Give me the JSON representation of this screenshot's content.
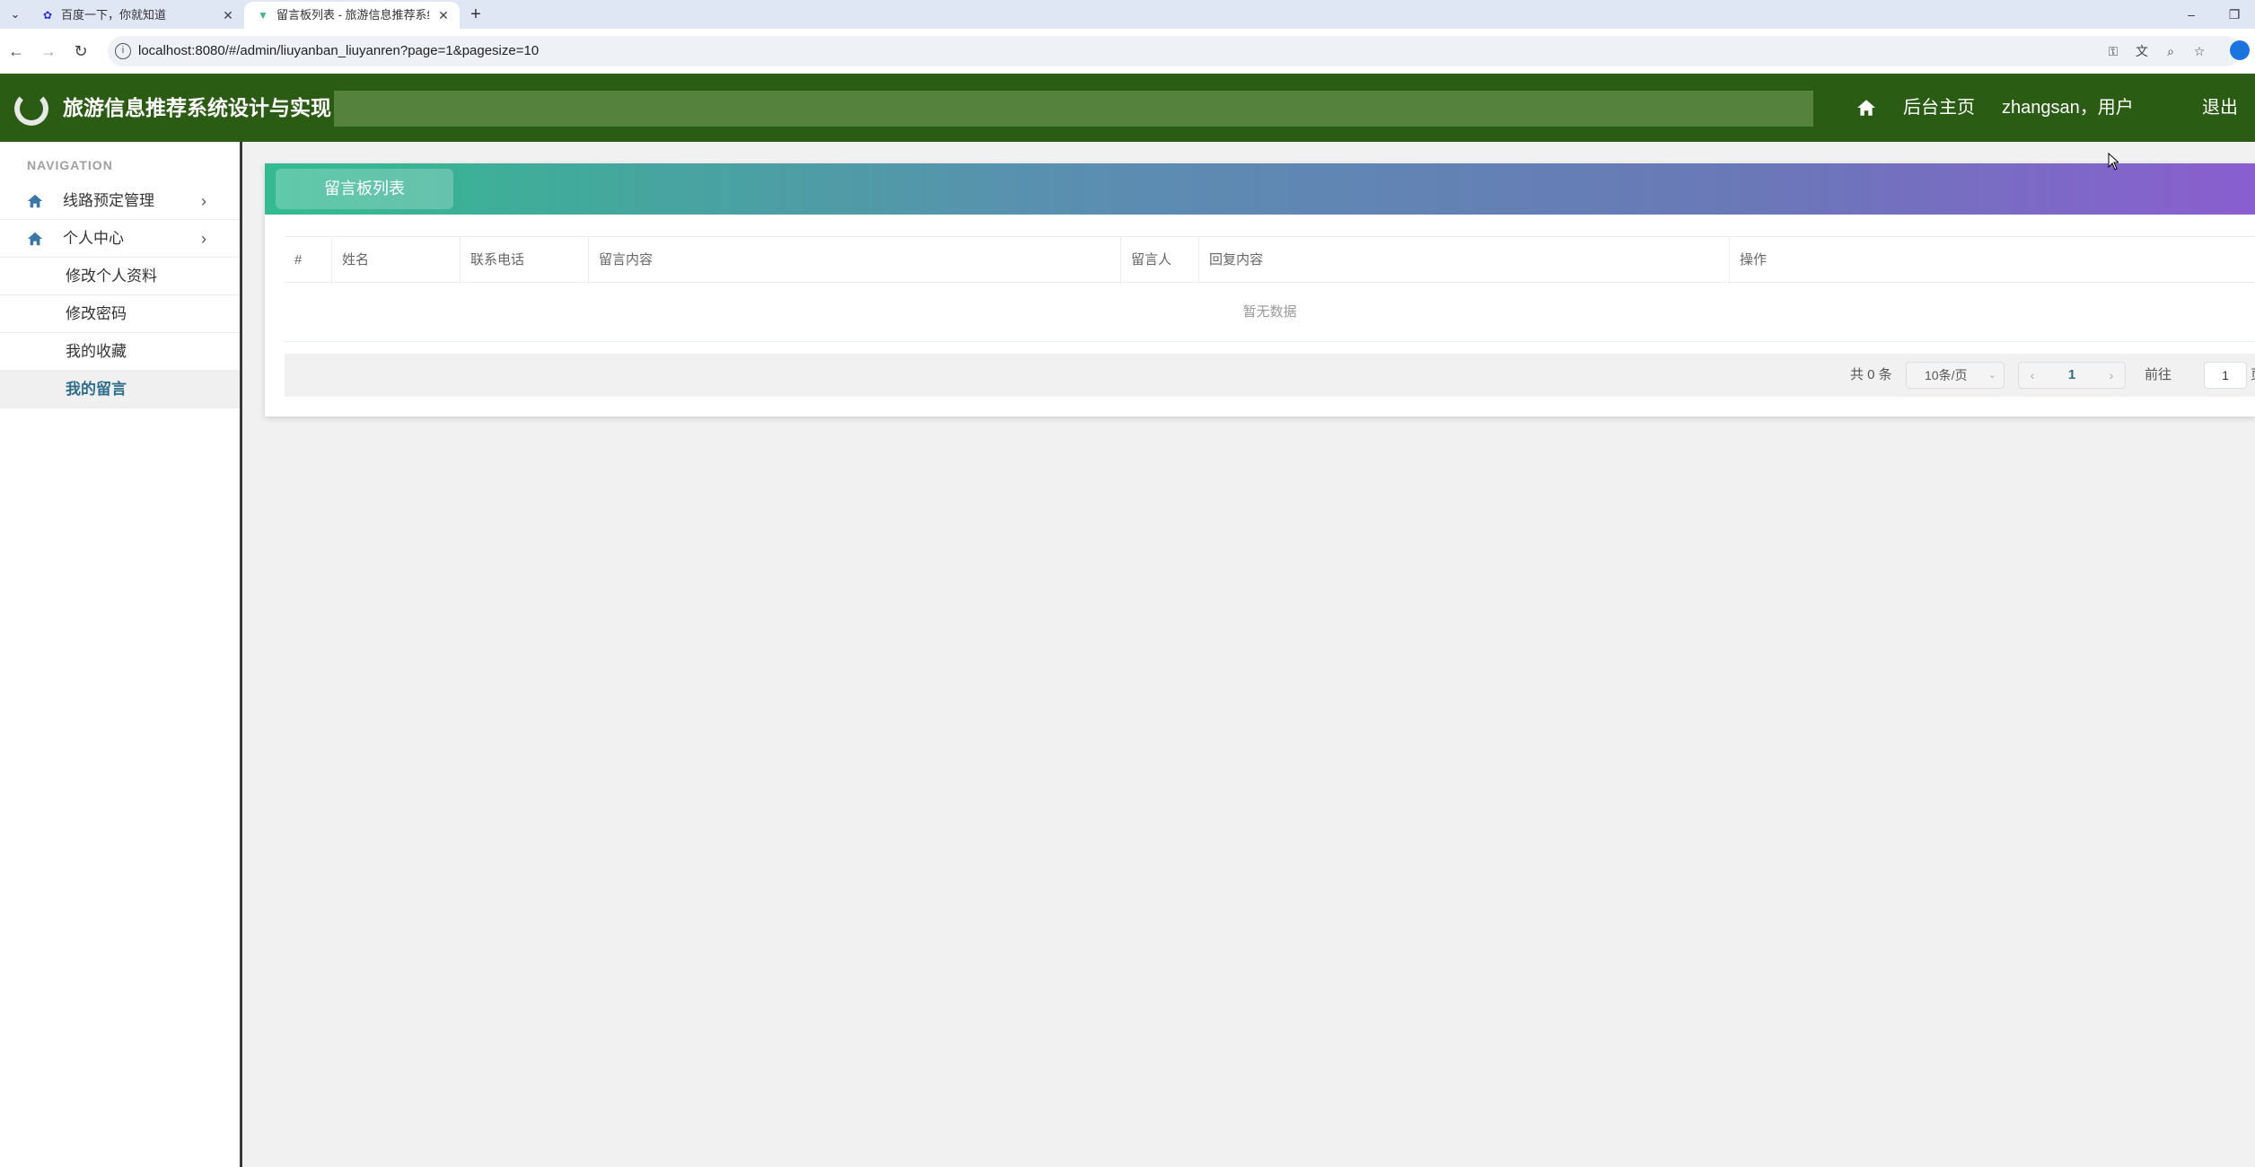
{
  "browser": {
    "tabs": [
      {
        "title": "百度一下，你就知道",
        "active": false
      },
      {
        "title": "留言板列表 - 旅游信息推荐系统",
        "active": true
      }
    ],
    "url": "localhost:8080/#/admin/liuyanban_liuyanren?page=1&pagesize=10",
    "profile_initial": "👤"
  },
  "header": {
    "title": "旅游信息推荐系统设计与实现",
    "home_link": "后台主页",
    "user": "zhangsan，用户",
    "logout": "退出",
    "colors": {
      "bar": "#2a5c13",
      "strip": "#55823c"
    }
  },
  "sidebar": {
    "heading": "NAVIGATION",
    "menus": [
      {
        "label": "线路预定管理",
        "icon": "home-icon"
      },
      {
        "label": "个人中心",
        "icon": "home-icon"
      }
    ],
    "sub_items": [
      "修改个人资料",
      "修改密码",
      "我的收藏",
      "我的留言"
    ],
    "active_sub": "我的留言"
  },
  "main": {
    "card_title": "留言板列表",
    "columns": [
      "#",
      "姓名",
      "联系电话",
      "留言内容",
      "留言人",
      "回复内容",
      "操作"
    ],
    "empty_text": "暂无数据",
    "pagination": {
      "total": "共 0 条",
      "page_size": "10条/页",
      "current": "1",
      "goto_label": "前往",
      "goto_value": "1",
      "page_unit": "页"
    }
  }
}
